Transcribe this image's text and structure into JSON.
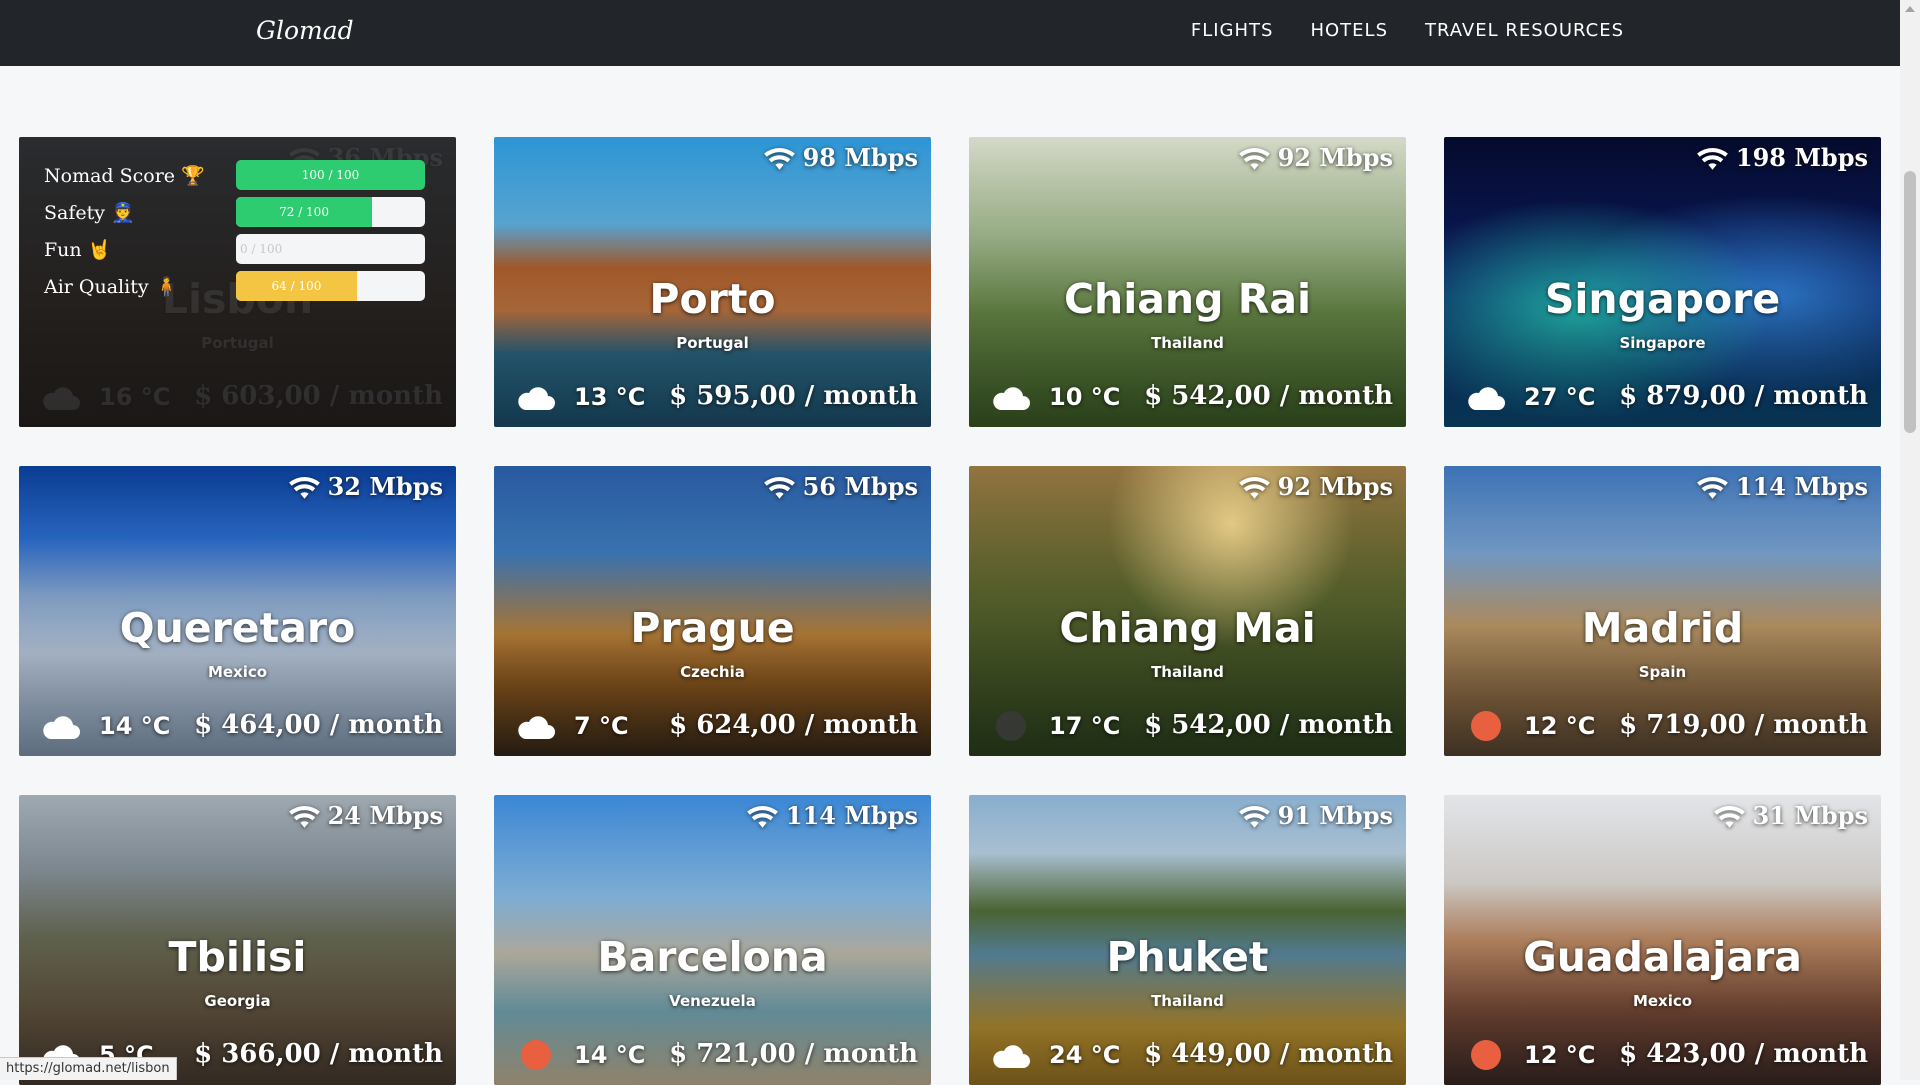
{
  "navbar": {
    "brand": "Glomad",
    "links": [
      "FLIGHTS",
      "HOTELS",
      "TRAVEL RESOURCES"
    ]
  },
  "hover_panel": {
    "rows": [
      {
        "label": "Nomad Score 🏆",
        "value_text": "100 / 100",
        "value": 100,
        "color": "#2ecc71"
      },
      {
        "label": "Safety 👮",
        "value_text": "72 / 100",
        "value": 72,
        "color": "#2ecc71"
      },
      {
        "label": "Fun 🤘",
        "value_text": "0 / 100",
        "value": 0,
        "color": "#2ecc71"
      },
      {
        "label": "Air Quality 🧍",
        "value_text": "64 / 100",
        "value": 64,
        "color": "#f4c542"
      }
    ]
  },
  "cards": [
    {
      "city": "Lisbon",
      "country": "Portugal",
      "wifi": "36 Mbps",
      "temp": "16 °C",
      "price": "$ 603,00 / month",
      "weather": "cloud",
      "bg": "bg-lisbon",
      "hovered": true
    },
    {
      "city": "Porto",
      "country": "Portugal",
      "wifi": "98 Mbps",
      "temp": "13 °C",
      "price": "$ 595,00 / month",
      "weather": "cloud",
      "bg": "bg-porto"
    },
    {
      "city": "Chiang Rai",
      "country": "Thailand",
      "wifi": "92 Mbps",
      "temp": "10 °C",
      "price": "$ 542,00 / month",
      "weather": "cloud",
      "bg": "bg-chiangrai"
    },
    {
      "city": "Singapore",
      "country": "Singapore",
      "wifi": "198 Mbps",
      "temp": "27 °C",
      "price": "$ 879,00 / month",
      "weather": "cloud",
      "bg": "bg-singapore"
    },
    {
      "city": "Queretaro",
      "country": "Mexico",
      "wifi": "32 Mbps",
      "temp": "14 °C",
      "price": "$ 464,00 / month",
      "weather": "cloud",
      "bg": "bg-queretaro"
    },
    {
      "city": "Prague",
      "country": "Czechia",
      "wifi": "56 Mbps",
      "temp": "7 °C",
      "price": "$ 624,00 / month",
      "weather": "cloud",
      "bg": "bg-prague"
    },
    {
      "city": "Chiang Mai",
      "country": "Thailand",
      "wifi": "92 Mbps",
      "temp": "17 °C",
      "price": "$ 542,00 / month",
      "weather": "moon",
      "bg": "bg-chiangmai"
    },
    {
      "city": "Madrid",
      "country": "Spain",
      "wifi": "114 Mbps",
      "temp": "12 °C",
      "price": "$ 719,00 / month",
      "weather": "sun",
      "bg": "bg-madrid"
    },
    {
      "city": "Tbilisi",
      "country": "Georgia",
      "wifi": "24 Mbps",
      "temp": "5 °C",
      "price": "$ 366,00 / month",
      "weather": "cloud",
      "bg": "bg-tbilisi"
    },
    {
      "city": "Barcelona",
      "country": "Venezuela",
      "wifi": "114 Mbps",
      "temp": "14 °C",
      "price": "$ 721,00 / month",
      "weather": "sun",
      "bg": "bg-barcelona"
    },
    {
      "city": "Phuket",
      "country": "Thailand",
      "wifi": "91 Mbps",
      "temp": "24 °C",
      "price": "$ 449,00 / month",
      "weather": "cloud",
      "bg": "bg-phuket"
    },
    {
      "city": "Guadalajara",
      "country": "Mexico",
      "wifi": "31 Mbps",
      "temp": "12 °C",
      "price": "$ 423,00 / month",
      "weather": "sun",
      "bg": "bg-guadalajara"
    }
  ],
  "status_url": "https://glomad.net/lisbon"
}
